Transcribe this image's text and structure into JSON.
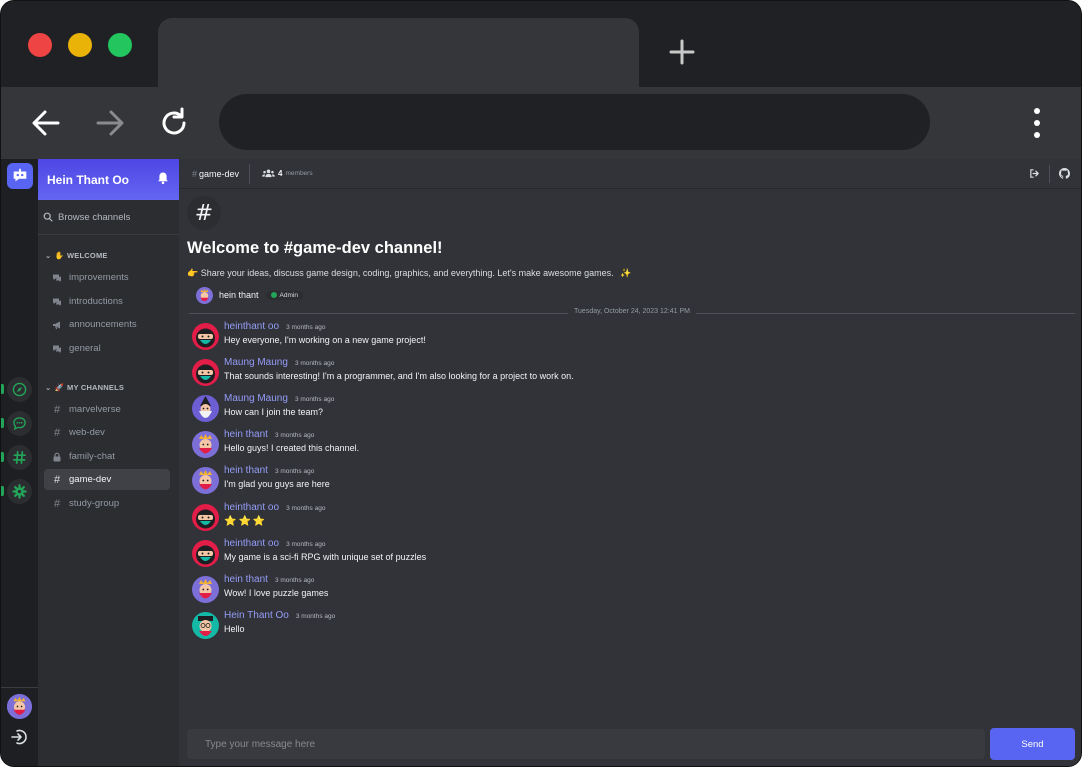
{
  "browser": {
    "url": ""
  },
  "server": {
    "name": "Hein Thant Oo"
  },
  "browse": {
    "label": "Browse channels"
  },
  "categories": {
    "welcome": "WELCOME",
    "my_channels": "MY CHANNELS"
  },
  "welcome_channels": [
    {
      "label": "improvements",
      "icon": "forum-icon"
    },
    {
      "label": "introductions",
      "icon": "forum-icon"
    },
    {
      "label": "announcements",
      "icon": "megaphone-icon"
    },
    {
      "label": "general",
      "icon": "forum-icon"
    }
  ],
  "my_channels": [
    {
      "label": "marvelverse",
      "icon": "hash-icon"
    },
    {
      "label": "web-dev",
      "icon": "hash-icon"
    },
    {
      "label": "family-chat",
      "icon": "lock-icon"
    },
    {
      "label": "game-dev",
      "icon": "hash-icon",
      "active": true
    },
    {
      "label": "study-group",
      "icon": "hash-icon"
    }
  ],
  "topbar": {
    "channel": "game-dev",
    "member_count": "4",
    "members_label": "members"
  },
  "hero": {
    "title": "Welcome to #game-dev channel!",
    "description": "Share your ideas, discuss game design, coding, graphics, and everything. Let's make awesome games.",
    "owner": "hein thant",
    "owner_badge": "Admin"
  },
  "date_divider": "Tuesday, October 24, 2023 12:41 PM",
  "messages": [
    {
      "author": "heinthant oo",
      "time": "3 months ago",
      "text": "Hey everyone, I'm working on a new game project!",
      "avatar": "ninja"
    },
    {
      "author": "Maung Maung",
      "time": "3 months ago",
      "text": "That sounds interesting! I'm a programmer, and I'm also looking for a project to work on.",
      "avatar": "ninja"
    },
    {
      "author": "Maung Maung",
      "time": "3 months ago",
      "text": "How can I join the team?",
      "avatar": "wizard"
    },
    {
      "author": "hein thant",
      "time": "3 months ago",
      "text": "Hello guys! I created this channel.",
      "avatar": "king"
    },
    {
      "author": "hein thant",
      "time": "3 months ago",
      "text": "I'm glad you guys are here",
      "avatar": "king"
    },
    {
      "author": "heinthant oo",
      "time": "3 months ago",
      "text": "⭐⭐⭐",
      "avatar": "ninja"
    },
    {
      "author": "heinthant oo",
      "time": "3 months ago",
      "text": "My game is a sci-fi RPG with unique set of puzzles",
      "avatar": "ninja"
    },
    {
      "author": "hein thant",
      "time": "3 months ago",
      "text": "Wow! I love puzzle games",
      "avatar": "king"
    },
    {
      "author": "Hein Thant Oo",
      "time": "3 months ago",
      "text": "Hello",
      "avatar": "scholar"
    }
  ],
  "composer": {
    "placeholder": "Type your message here",
    "send_label": "Send"
  },
  "colors": {
    "accent": "#5865f2",
    "author_name": "#949cf7",
    "online": "#23a559",
    "rail_bg": "#1e1f22",
    "sidebar_bg": "#2b2d31",
    "main_bg": "#313338"
  }
}
